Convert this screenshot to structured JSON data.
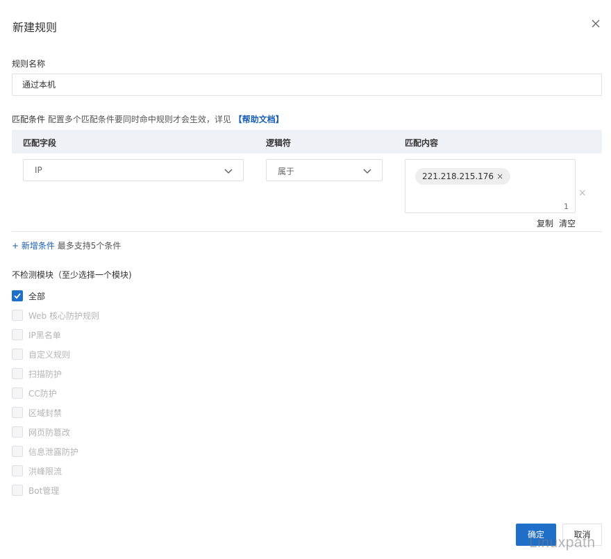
{
  "dialog": {
    "title": "新建规则",
    "close_icon": "close-icon"
  },
  "rule_name": {
    "label": "规则名称",
    "value": "通过本机"
  },
  "conditions": {
    "label": "匹配条件",
    "hint": "配置多个匹配条件要同时命中规则才会生效，详见",
    "help_link": "【帮助文档】",
    "columns": [
      "匹配字段",
      "逻辑符",
      "匹配内容"
    ],
    "rows": [
      {
        "field": "IP",
        "operator": "属于",
        "tags": [
          "221.218.215.176"
        ],
        "tag_remove": "×",
        "count": "1",
        "row_remove": "×"
      }
    ],
    "copy_label": "复制",
    "clear_label": "清空",
    "add_label": "+ 新增条件",
    "add_hint": "最多支持5个条件"
  },
  "modules": {
    "title": "不检测模块（至少选择一个模块)",
    "items": [
      {
        "label": "全部",
        "checked": true,
        "disabled": false
      },
      {
        "label": "Web 核心防护规则",
        "checked": false,
        "disabled": true
      },
      {
        "label": "IP黑名单",
        "checked": false,
        "disabled": true
      },
      {
        "label": "自定义规则",
        "checked": false,
        "disabled": true
      },
      {
        "label": "扫描防护",
        "checked": false,
        "disabled": true
      },
      {
        "label": "CC防护",
        "checked": false,
        "disabled": true
      },
      {
        "label": "区域封禁",
        "checked": false,
        "disabled": true
      },
      {
        "label": "网页防篡改",
        "checked": false,
        "disabled": true
      },
      {
        "label": "信息泄露防护",
        "checked": false,
        "disabled": true
      },
      {
        "label": "洪峰限流",
        "checked": false,
        "disabled": true
      },
      {
        "label": "Bot管理",
        "checked": false,
        "disabled": true
      }
    ]
  },
  "footer": {
    "ok_label": "确定",
    "cancel_label": "取消"
  },
  "watermark": "Linuxpath",
  "colors": {
    "primary": "#1f6fc9",
    "link": "#1a5fb4",
    "header_bg": "#eef1f6"
  }
}
